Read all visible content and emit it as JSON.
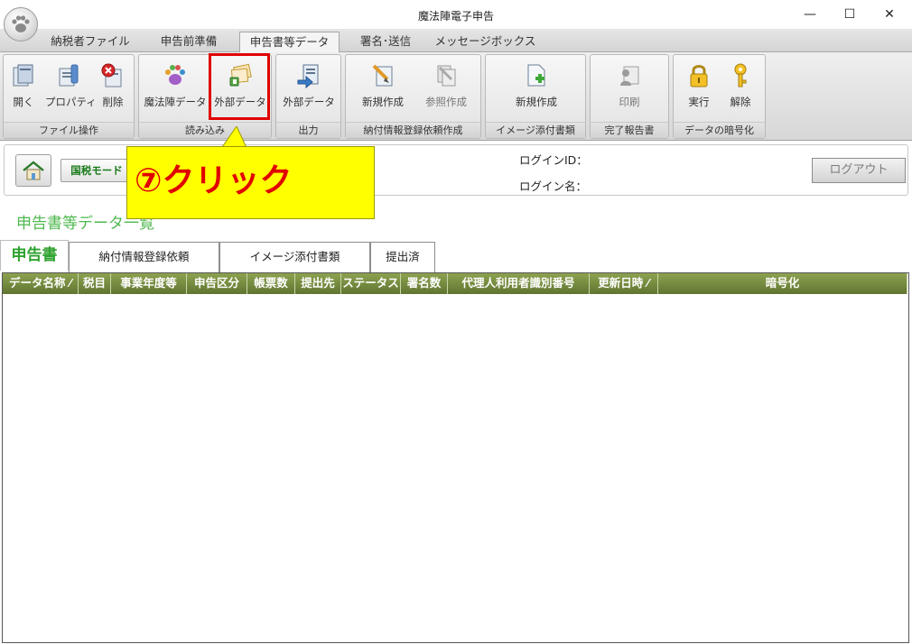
{
  "window": {
    "title": "魔法陣電子申告",
    "minimize": "—",
    "maximize": "☐",
    "close": "✕"
  },
  "menu_tabs": [
    {
      "label": "納税者ファイル",
      "active": false
    },
    {
      "label": "申告前準備",
      "active": false
    },
    {
      "label": "申告書等データ",
      "active": true
    },
    {
      "label": "署名･送信",
      "active": false
    },
    {
      "label": "メッセージボックス",
      "active": false
    }
  ],
  "ribbon": {
    "groups": [
      {
        "label": "ファイル操作",
        "buttons": [
          "開く",
          "プロパティ",
          "削除"
        ]
      },
      {
        "label": "読み込み",
        "buttons": [
          "魔法陣データ",
          "外部データ"
        ]
      },
      {
        "label": "出力",
        "buttons": [
          "外部データ"
        ]
      },
      {
        "label": "納付情報登録依頼作成",
        "buttons": [
          "新規作成",
          "参照作成"
        ]
      },
      {
        "label": "イメージ添付書類",
        "buttons": [
          "新規作成"
        ]
      },
      {
        "label": "完了報告書",
        "buttons": [
          "印刷"
        ]
      },
      {
        "label": "データの暗号化",
        "buttons": [
          "実行",
          "解除"
        ]
      }
    ]
  },
  "login": {
    "mode_label": "国税モード",
    "login_id_label": "ログインID：",
    "login_name_label": "ログイン名：",
    "logout_label": "ログアウト"
  },
  "page_title": "申告書等データ一覧",
  "sub_tabs": [
    "申告書",
    "納付情報登録依頼",
    "イメージ添付書類",
    "提出済"
  ],
  "table": {
    "columns": [
      "データ名称 ⁄",
      "税目",
      "事業年度等",
      "申告区分",
      "帳票数",
      "提出先",
      "ステータス",
      "署名数",
      "代理人利用者識別番号",
      "更新日時 ⁄",
      "暗号化"
    ],
    "rows": []
  },
  "annotation": {
    "text": "⑦クリック",
    "color": "#e00000",
    "background": "#ffff00"
  }
}
